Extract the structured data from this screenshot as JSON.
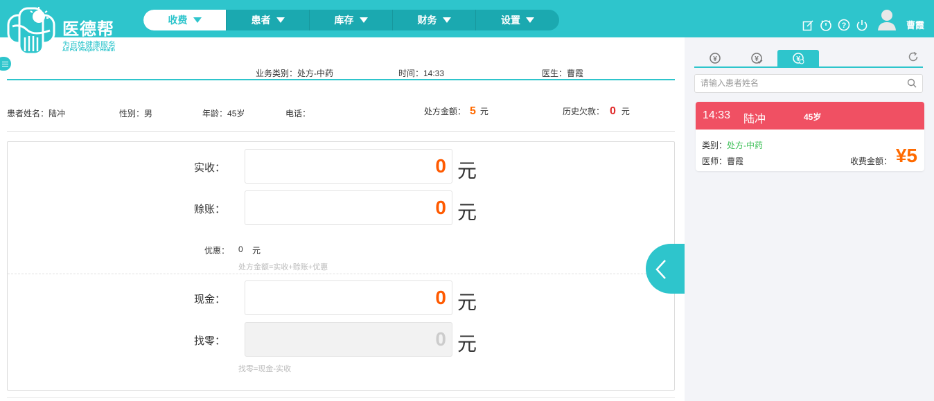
{
  "brand": {
    "name": "医德帮",
    "slogan": "为百姓健康服务",
    "slogan_en": "All For People's Health"
  },
  "nav": {
    "items": [
      "收费",
      "患者",
      "库存",
      "财务",
      "设置"
    ],
    "active_index": 0
  },
  "header_icons": [
    "edit-icon",
    "timer-icon",
    "help-icon",
    "power-icon"
  ],
  "user": {
    "name": "曹霞"
  },
  "record": {
    "business_type_label": "业务类别：处方-中药",
    "time_label": "时间：14:33",
    "doctor_label": "医生：曹霞"
  },
  "patient": {
    "name_label": "患者姓名：",
    "name": "陆冲",
    "gender_label": "性别：",
    "gender": "男",
    "age_label": "年龄：",
    "age": "45岁",
    "phone_label": "电话：",
    "phone": "",
    "amount_label": "处方金额：",
    "amount": "5",
    "amount_unit": "元",
    "debt_label": "历史欠款：",
    "debt": "0",
    "debt_unit": "元"
  },
  "payment": {
    "received_label": "实收：",
    "received": "0",
    "credit_label": "赊账：",
    "credit": "0",
    "discount_label": "优惠：",
    "discount": "0",
    "discount_unit": "元",
    "formula1": "处方金额=实收+赊账+优惠",
    "cash_label": "现金：",
    "cash": "0",
    "change_label": "找零：",
    "change": "0",
    "formula2": "找零=现金-实收",
    "unit": "元"
  },
  "right": {
    "tab_icons": [
      "yuan-coin-icon",
      "yuan-coin-check-icon",
      "yuan-coin-clock-icon"
    ],
    "active_tab": 2,
    "search_placeholder": "请输入患者姓名",
    "card": {
      "time": "14:33",
      "name": "陆冲",
      "age": "45岁",
      "type_label": "类别：",
      "type": "处方-中药",
      "doctor_label": "医师：",
      "doctor": "曹霞",
      "fee_label": "收费金额：",
      "fee": "¥5"
    }
  },
  "colors": {
    "primary": "#2ec5cc",
    "accent_orange": "#ff5a00",
    "card_red": "#f05063",
    "green": "#3bbf55"
  }
}
